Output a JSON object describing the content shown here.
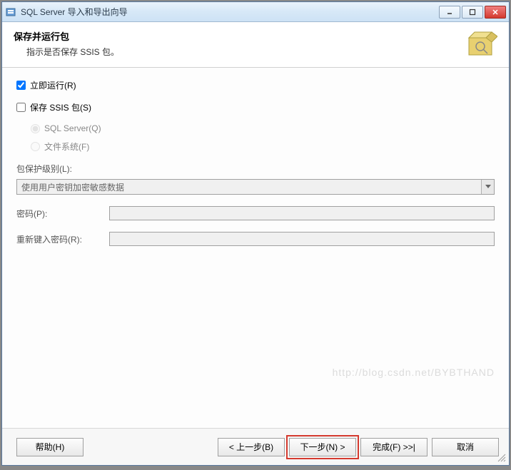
{
  "window": {
    "title": "SQL Server 导入和导出向导"
  },
  "header": {
    "title": "保存并运行包",
    "subtitle": "指示是否保存 SSIS 包。"
  },
  "options": {
    "run_immediately": {
      "label": "立即运行(R)",
      "checked": true
    },
    "save_ssis": {
      "label": "保存 SSIS 包(S)",
      "checked": false
    },
    "storage": {
      "sql_server": "SQL Server(Q)",
      "file_system": "文件系统(F)"
    }
  },
  "protection": {
    "level_label": "包保护级别(L):",
    "selected": "使用用户密钥加密敏感数据",
    "password_label": "密码(P):",
    "retype_label": "重新键入密码(R):"
  },
  "footer": {
    "help": "帮助(H)",
    "back": "< 上一步(B)",
    "next": "下一步(N) >",
    "finish": "完成(F) >>|",
    "cancel": "取消"
  },
  "watermark": "http://blog.csdn.net/BYBTHAND"
}
